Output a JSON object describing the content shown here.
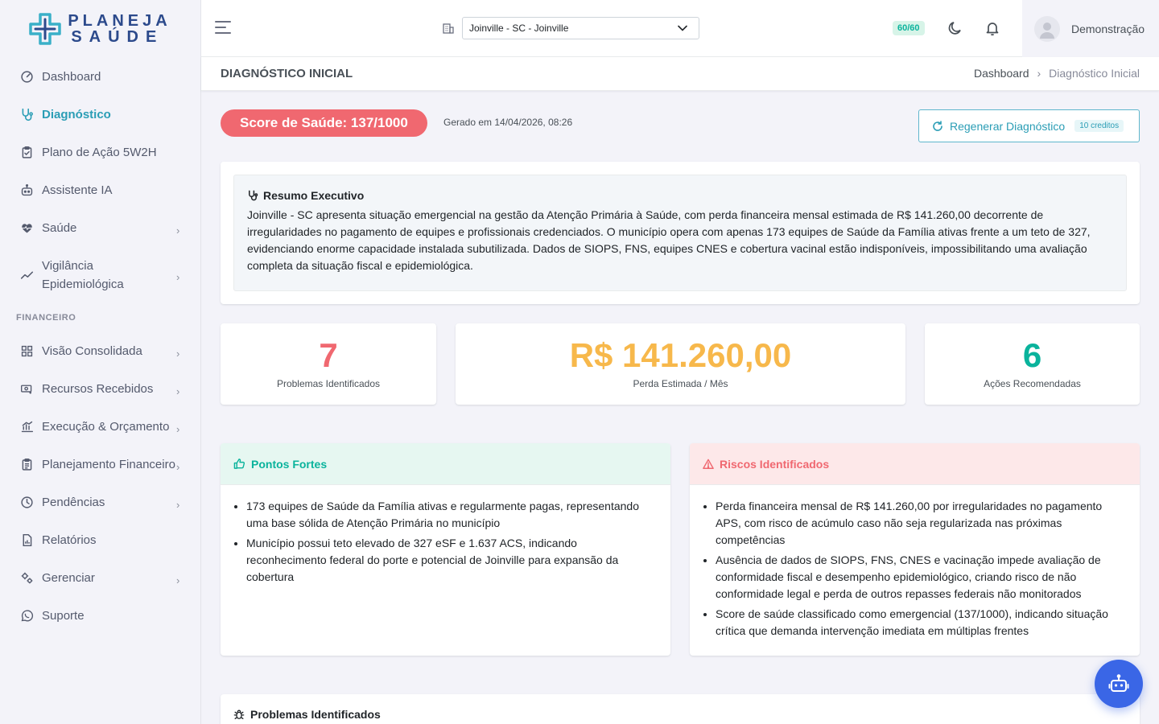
{
  "brand": {
    "line1": "PLANEJA",
    "line2": "SAÚDE"
  },
  "sidebar": {
    "items": [
      {
        "label": "Dashboard",
        "icon": "speedometer-icon"
      },
      {
        "label": "Diagnóstico",
        "icon": "stethoscope-icon",
        "active": true
      },
      {
        "label": "Plano de Ação 5W2H",
        "icon": "clipboard-check-icon"
      },
      {
        "label": "Assistente IA",
        "icon": "robot-icon"
      },
      {
        "label": "Saúde",
        "icon": "heart-pulse-icon"
      },
      {
        "label": "Vigilância Epidemiológica",
        "icon": "trend-icon"
      }
    ],
    "section_label": "FINANCEIRO",
    "finance_items": [
      {
        "label": "Visão Consolidada",
        "icon": "grid-icon"
      },
      {
        "label": "Recursos Recebidos",
        "icon": "money-icon"
      },
      {
        "label": "Execução & Orçamento",
        "icon": "bar-chart-icon"
      },
      {
        "label": "Planejamento Financeiro",
        "icon": "clipboard-icon"
      },
      {
        "label": "Pendências",
        "icon": "clock-icon"
      },
      {
        "label": "Relatórios",
        "icon": "report-icon"
      },
      {
        "label": "Gerenciar",
        "icon": "gears-icon"
      },
      {
        "label": "Suporte",
        "icon": "whatsapp-icon"
      }
    ]
  },
  "topbar": {
    "city_selected": "Joinville - SC - Joinville",
    "credits_badge": "60/60",
    "user_name": "Demonstração"
  },
  "page": {
    "title": "DIAGNÓSTICO INICIAL",
    "breadcrumb_home": "Dashboard",
    "breadcrumb_current": "Diagnóstico Inicial"
  },
  "score": {
    "label": "Score de Saúde: 137/1000",
    "generated": "Gerado em 14/04/2026, 08:26",
    "regen_label": "Regenerar Diagnóstico",
    "regen_badge": "10 creditos"
  },
  "summary": {
    "title": "Resumo Executivo",
    "text": "Joinville - SC apresenta situação emergencial na gestão da Atenção Primária à Saúde, com perda financeira mensal estimada de R$ 141.260,00 decorrente de irregularidades no pagamento de equipes e profissionais credenciados. O município opera com apenas 173 equipes de Saúde da Família ativas frente a um teto de 327, evidenciando enorme capacidade instalada subutilizada. Dados de SIOPS, FNS, equipes CNES e cobertura vacinal estão indisponíveis, impossibilitando uma avaliação completa da situação fiscal e epidemiológica."
  },
  "stats": [
    {
      "value": "7",
      "label": "Problemas Identificados",
      "color": "#f06870"
    },
    {
      "value": "R$ 141.260,00",
      "label": "Perda Estimada / Mês",
      "color": "#f7b84b"
    },
    {
      "value": "6",
      "label": "Ações Recomendadas",
      "color": "#0ab39c"
    }
  ],
  "strengths": {
    "title": "Pontos Fortes",
    "items": [
      "173 equipes de Saúde da Família ativas e regularmente pagas, representando uma base sólida de Atenção Primária no município",
      "Município possui teto elevado de 327 eSF e 1.637 ACS, indicando reconhecimento federal do porte e potencial de Joinville para expansão da cobertura"
    ]
  },
  "risks": {
    "title": "Riscos Identificados",
    "items": [
      "Perda financeira mensal de R$ 141.260,00 por irregularidades no pagamento APS, com risco de acúmulo caso não seja regularizada nas próximas competências",
      "Ausência de dados de SIOPS, FNS, CNES e vacinação impede avaliação de conformidade fiscal e desempenho epidemiológico, criando risco de não conformidade legal e perda de outros repasses federais não monitorados",
      "Score de saúde classificado como emergencial (137/1000), indicando situação crítica que demanda intervenção imediata em múltiplas frentes"
    ]
  },
  "problems": {
    "title": "Problemas Identificados"
  },
  "colors": {
    "accent": "#2a9db5",
    "danger": "#f06870",
    "warning": "#f7b84b",
    "success": "#0ab39c",
    "fab": "#3a66e6"
  }
}
